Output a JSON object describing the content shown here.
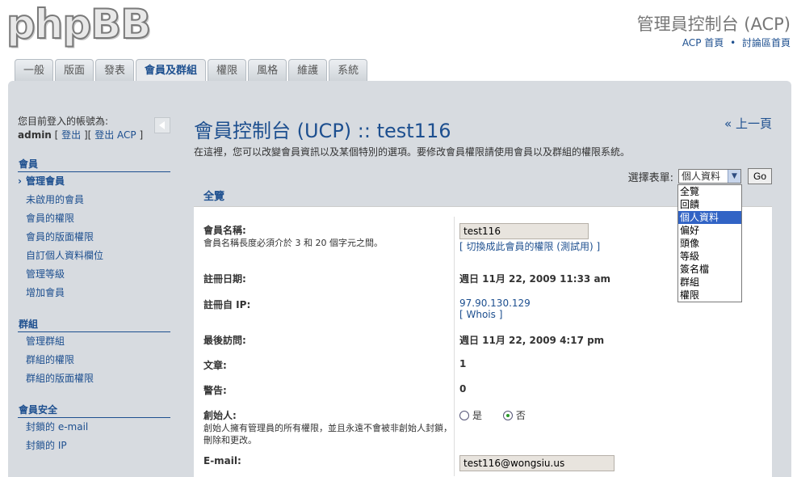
{
  "header": {
    "logo": "phpBB",
    "title": "管理員控制台 (ACP)",
    "links": [
      "ACP 首頁",
      "討論區首頁"
    ],
    "link_sep": "•"
  },
  "tabs": [
    {
      "label": "一般",
      "active": false
    },
    {
      "label": "版面",
      "active": false
    },
    {
      "label": "發表",
      "active": false
    },
    {
      "label": "會員及群組",
      "active": true
    },
    {
      "label": "權限",
      "active": false
    },
    {
      "label": "風格",
      "active": false
    },
    {
      "label": "維護",
      "active": false
    },
    {
      "label": "系統",
      "active": false
    }
  ],
  "sidebar": {
    "login_prefix": "您目前登入的帳號為:",
    "username": "admin",
    "logout": "登出",
    "logout_acp": "登出 ACP",
    "sections": [
      {
        "title": "會員",
        "items": [
          "管理會員",
          "未啟用的會員",
          "會員的權限",
          "會員的版面權限",
          "自訂個人資料欄位",
          "管理等級",
          "增加會員"
        ]
      },
      {
        "title": "群組",
        "items": [
          "管理群組",
          "群組的權限",
          "群組的版面權限"
        ]
      },
      {
        "title": "會員安全",
        "items": [
          "封鎖的 e-mail",
          "封鎖的 IP"
        ]
      }
    ]
  },
  "main": {
    "title": "會員控制台 (UCP) :: test116",
    "back": "« 上一頁",
    "description": "在這裡，您可以改變會員資訊以及某個特別的選項。要修改會員權限請使用會員以及群組的權限系統。",
    "select_label": "選擇表單:",
    "select_value": "個人資料",
    "go": "Go",
    "options": [
      "全覽",
      "回饋",
      "個人資料",
      "偏好",
      "頭像",
      "等級",
      "簽名檔",
      "群組",
      "權限"
    ],
    "highlighted_option": "個人資料",
    "sub_tab": "全覽"
  },
  "form": {
    "username_label": "會員名稱:",
    "username_desc": "會員名稱長度必須介於 3 和 20 個字元之間。",
    "username_value": "test116",
    "switch_perm": "[ 切換成此會員的權限 (測試用) ]",
    "reg_date_label": "註冊日期:",
    "reg_date_value": "週日 11月 22, 2009 11:33 am",
    "reg_ip_label": "註冊自 IP:",
    "reg_ip_value": "97.90.130.129",
    "whois": "[ Whois ]",
    "last_visit_label": "最後訪問:",
    "last_visit_value": "週日 11月 22, 2009 4:17 pm",
    "posts_label": "文章:",
    "posts_value": "1",
    "warnings_label": "警告:",
    "warnings_value": "0",
    "founder_label": "創始人:",
    "founder_desc": "創始人擁有管理員的所有權限，並且永遠不會被非創始人封鎖，刪除和更改。",
    "yes": "是",
    "no": "否",
    "founder_selected": "否",
    "email_label": "E-mail:",
    "email_value": "test116@wongsiu.us"
  }
}
